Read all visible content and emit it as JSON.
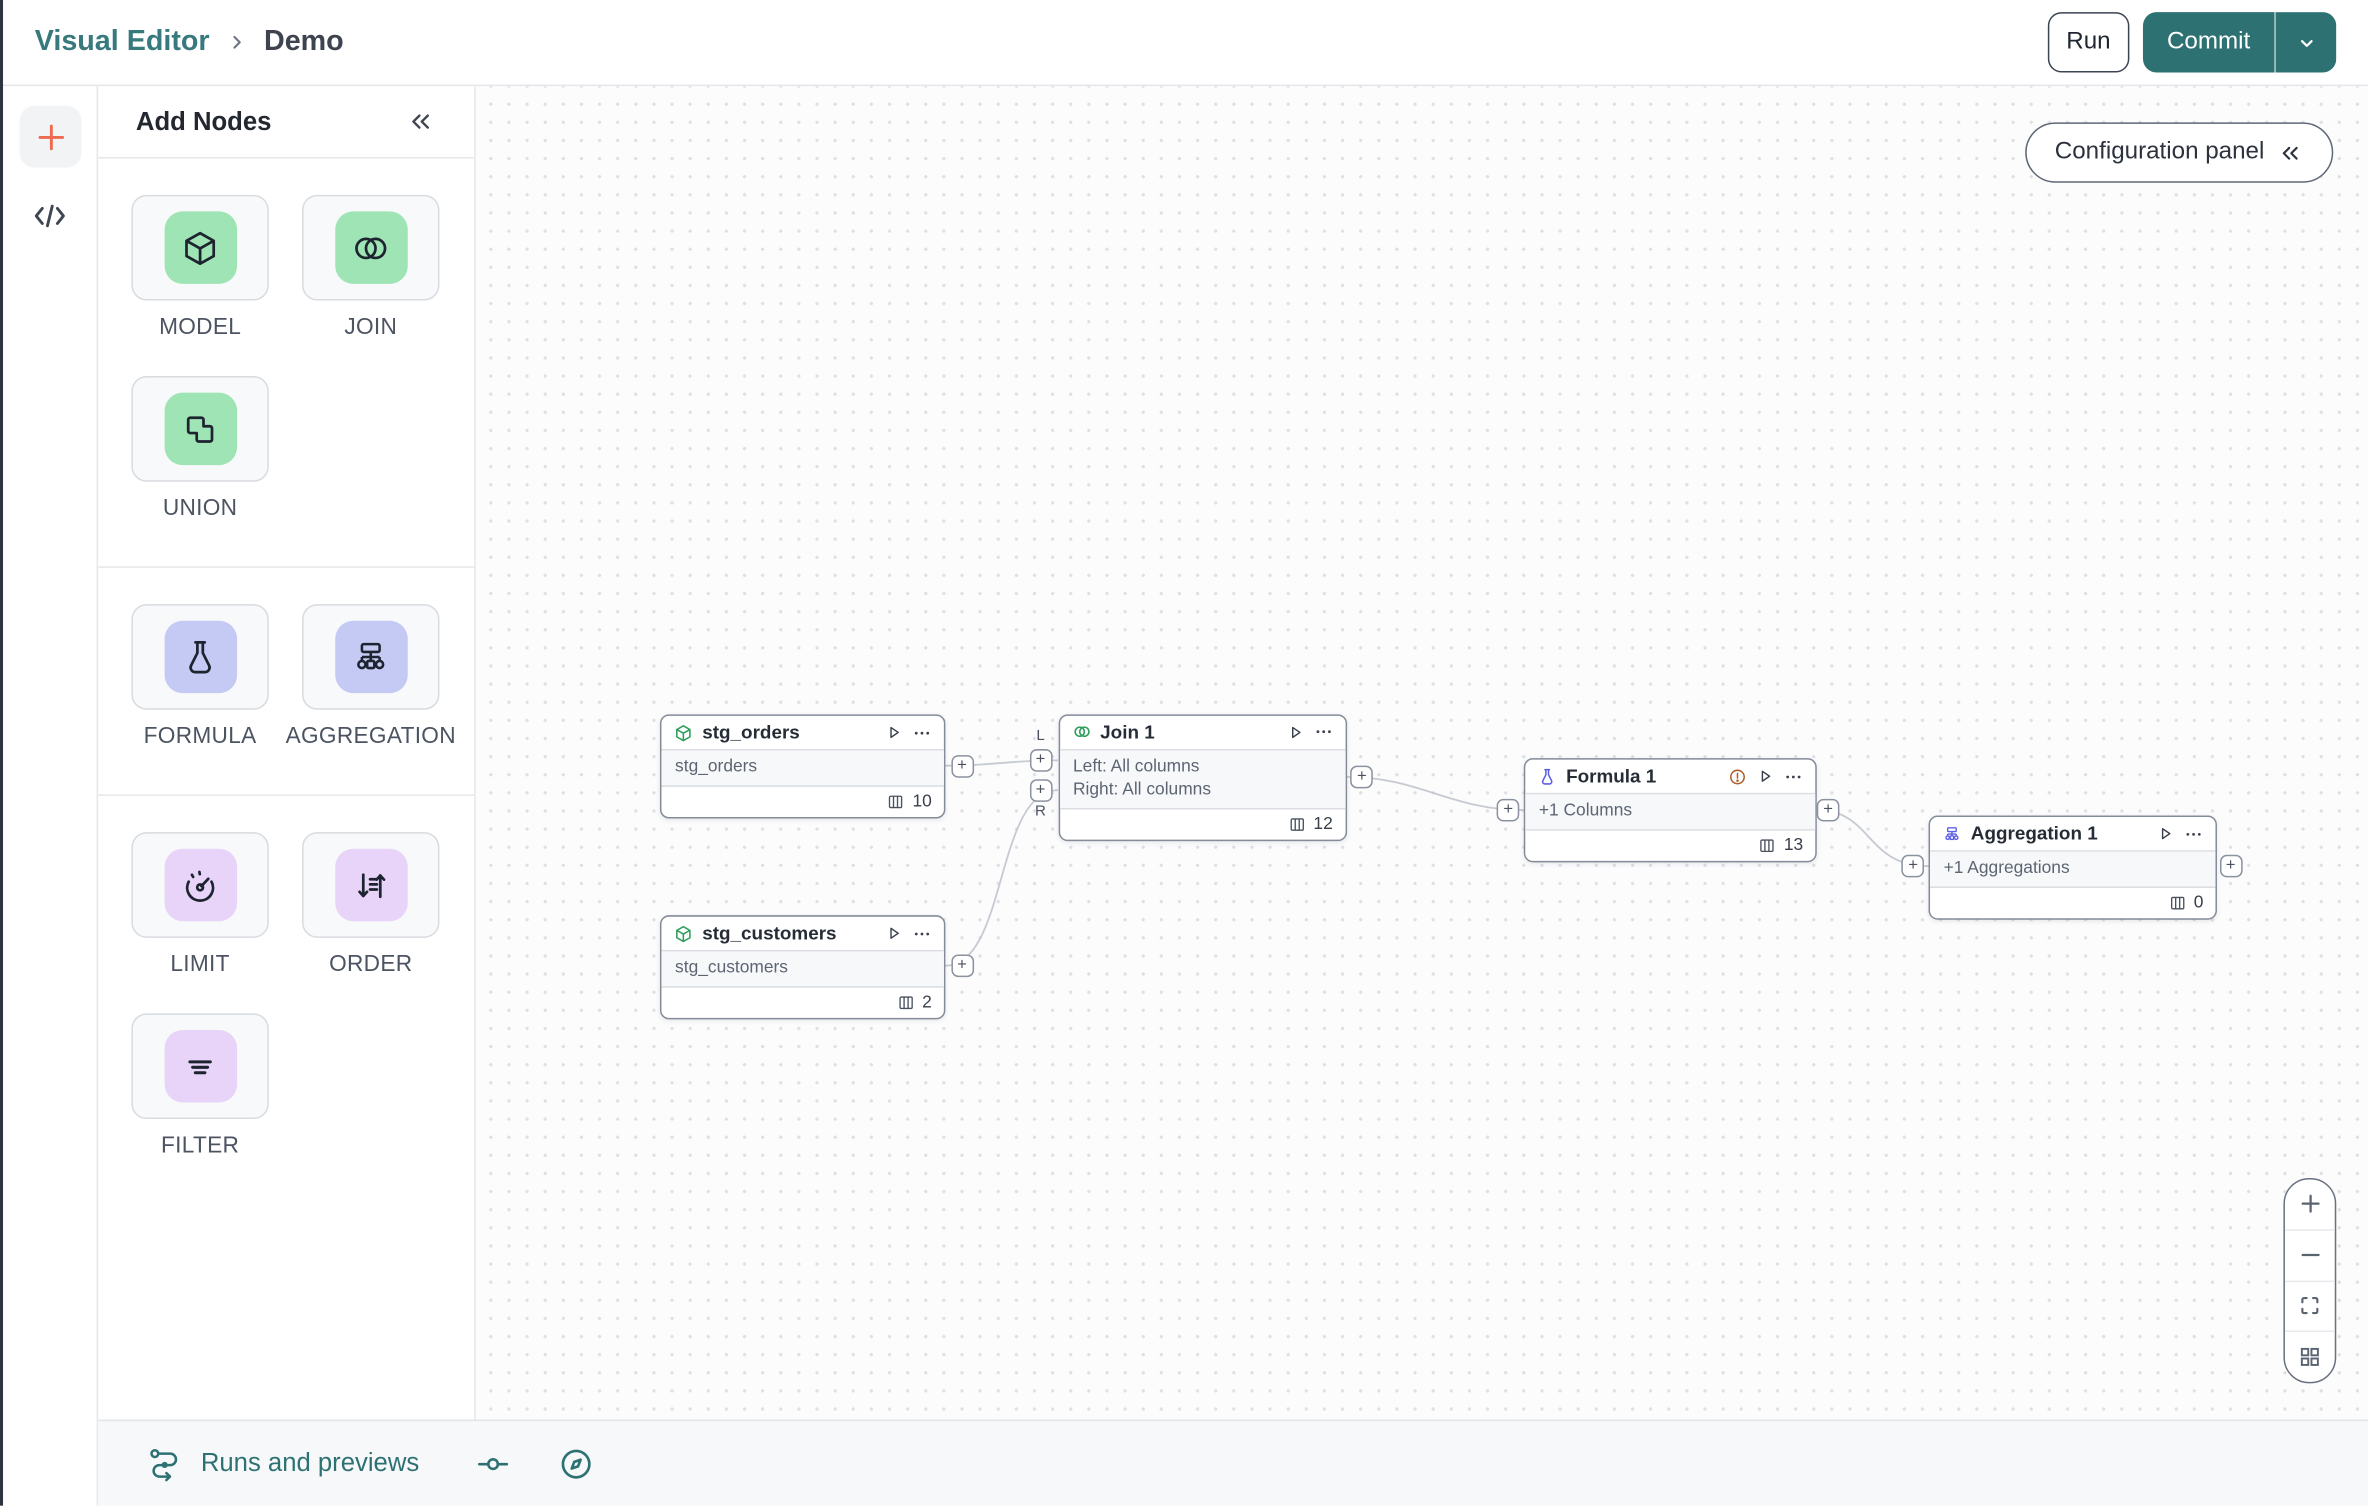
{
  "header": {
    "breadcrumb_root": "Visual Editor",
    "breadcrumb_current": "Demo",
    "run_button": "Run",
    "commit_button": "Commit"
  },
  "panel": {
    "title": "Add Nodes",
    "tiles": [
      {
        "label": "MODEL",
        "color": "green"
      },
      {
        "label": "JOIN",
        "color": "green"
      },
      {
        "label": "UNION",
        "color": "green"
      },
      {
        "label": "FORMULA",
        "color": "periwinkle"
      },
      {
        "label": "AGGREGATION",
        "color": "periwinkle"
      },
      {
        "label": "LIMIT",
        "color": "lilac"
      },
      {
        "label": "ORDER",
        "color": "lilac"
      },
      {
        "label": "FILTER",
        "color": "lilac"
      }
    ]
  },
  "canvas": {
    "config_panel_button": "Configuration panel",
    "plus": "+",
    "join_left_label": "L",
    "join_right_label": "R",
    "nodes": [
      {
        "title": "stg_orders",
        "body": "stg_orders",
        "columns": "10"
      },
      {
        "title": "stg_customers",
        "body": "stg_customers",
        "columns": "2"
      },
      {
        "title": "Join 1",
        "body_left": "Left: All columns",
        "body_right": "Right: All columns",
        "columns": "12"
      },
      {
        "title": "Formula 1",
        "body": "+1 Columns",
        "columns": "13"
      },
      {
        "title": "Aggregation 1",
        "body": "+1 Aggregations",
        "columns": "0"
      }
    ]
  },
  "bottom_bar": {
    "runs_label": "Runs and previews"
  },
  "colors": {
    "teal": "#2E7173",
    "orange": "#ED6A4F",
    "tile_green": "#9FE4B4",
    "tile_periwinkle": "#C4CAF4",
    "tile_lilac": "#E7D4F8",
    "warning": "#B05E2E",
    "node_icon_green": "#2E9E5B",
    "node_icon_indigo": "#5D5FE8"
  }
}
